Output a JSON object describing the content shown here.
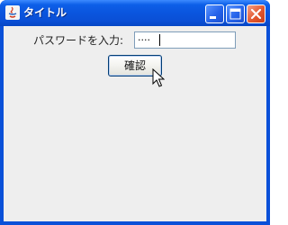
{
  "window": {
    "title": "タイトル",
    "controls": {
      "minimize_icon": "minimize-icon",
      "maximize_icon": "maximize-icon",
      "close_icon": "close-icon"
    },
    "colors": {
      "titlebar": "#0a55de",
      "client_background": "#eeeeee",
      "close_button": "#e3572e"
    }
  },
  "form": {
    "password_label": "パスワードを入力:",
    "password_value_masked": "····",
    "confirm_label": "確認"
  }
}
